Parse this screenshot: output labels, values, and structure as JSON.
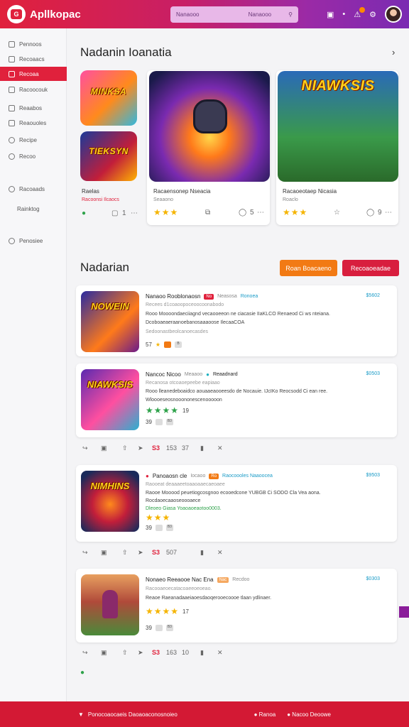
{
  "header": {
    "logo_glyph": "G",
    "app_title": "Apllkopac",
    "search_placeholder": "Nanaooo",
    "search_mid": "Nanaooo",
    "badge_color": "#ff8a00"
  },
  "sidebar": {
    "items": [
      {
        "label": "Pennoos"
      },
      {
        "label": "Recoaacs"
      },
      {
        "label": "Recoaa"
      },
      {
        "label": "Racoocouk"
      },
      {
        "label": "Reaabos"
      },
      {
        "label": "Reaouoles"
      },
      {
        "label": "Recipe"
      },
      {
        "label": "Recoo"
      },
      {
        "label": "Racoaads"
      },
      {
        "label": "Rainktog"
      },
      {
        "label": "Penosiee"
      }
    ]
  },
  "featured": {
    "title": "Nadanin Ioanatia",
    "tiles": [
      {
        "label": "MINKSA"
      },
      {
        "label": "TIEKSYN"
      }
    ],
    "cards": [
      {
        "title": "Raelas",
        "sub": "Racoonsi Ilcaocs",
        "count": "1"
      },
      {
        "title": "Racaensonep Nseacia",
        "sub": "Seaaono",
        "count": "5"
      },
      {
        "title": "Racaoeotaep Nicasia",
        "sub": "Roaclo",
        "count": "9",
        "art": "NIAWKSIS"
      }
    ]
  },
  "list_section": {
    "title": "Nadarian",
    "btn_primary": "Roan Boacaeno",
    "btn_secondary": "Recoaoeadae",
    "btn_primary_color": "#f27a14",
    "btn_secondary_color": "#d81e3e",
    "rows": [
      {
        "art": "NOWEIN",
        "title": "Nanaoo Rooblonaosn",
        "tag": "No",
        "tag2": "Neasosa",
        "tag3": "Ronoea",
        "price": "$5602",
        "l1": "Recees d1coaoopoceoocoonabodo",
        "l2": "Rooo Moooondaeciiagnd vecaooeeon ne ciacasie IIaKLCO Renaeod Ci ws nteiana.",
        "l3": "Dcoboaeaeraanoebanosaaaoose IlecaaCOA",
        "l4": "Sedoonastbeolcanoecasdes",
        "meta_num": "57",
        "meta2": "B"
      },
      {
        "art": "NIAWKSIS",
        "title": "Nancoc Nicoo",
        "tag": "Meaaoo",
        "tag2": "Reaadnard",
        "price": "$0503",
        "l1": "Recanosa otcoaoepeebe eapiaao",
        "l2": "Rooo lleanedeboaidco aouaaeaooeesdo de Nocauie. IJcIKo Reocsodd Ci ean ree.",
        "l3": "Wloooeseosnooononescenooooon",
        "meta_num": "19",
        "meta_count": "39",
        "meta2": "B3"
      },
      {
        "art": "NIMHINS",
        "title": "Panoaosn cle",
        "tag": "Iocaoo",
        "tag2": "Ro",
        "tag3": "Raocoooles Naaoocea",
        "price": "$9503",
        "l1": "Raooeat deaaaeetoaaoaaecaeoaee",
        "l2": "Raooe Mooood peuetiogcosgnoo ecooedcone YUBGB Ci SODO Cla Vea aona.",
        "l3": "Rocdaoecaaoseoooaece",
        "l4": "Dleoeo Giasa Yoaoaoeaotoo0003.",
        "meta_count": "39",
        "meta2": "B3"
      },
      {
        "art": "",
        "title": "Nonaeo Reeaooe Nac Ena",
        "tag": "Nac",
        "tag2": "Recdoo",
        "price": "$0303",
        "l1": "Racooaeoecatacoaeeoeoeao.",
        "l2": "Reaoe Raeanadaaeiaoesdaoqerooecoooe tlaan ydlinaer.",
        "meta_num": "17",
        "meta_count": "39",
        "meta2": "B3"
      }
    ],
    "action_bars": [
      {
        "n1": "S3",
        "n2": "153",
        "n3": "37"
      },
      {
        "n1": "S3",
        "n2": "507",
        "n3": ""
      },
      {
        "n1": "S3",
        "n2": "163",
        "n3": "10"
      }
    ]
  },
  "footer": {
    "left": "Ponocoaocaeis Daoaoaconosnoieo",
    "right1": "Ranoa",
    "right2": "Nacoo Deoowe"
  },
  "colors": {
    "accent": "#e0213c",
    "purple": "#7a2bb2",
    "star": "#f5b400",
    "green_star": "#2ea24a"
  }
}
